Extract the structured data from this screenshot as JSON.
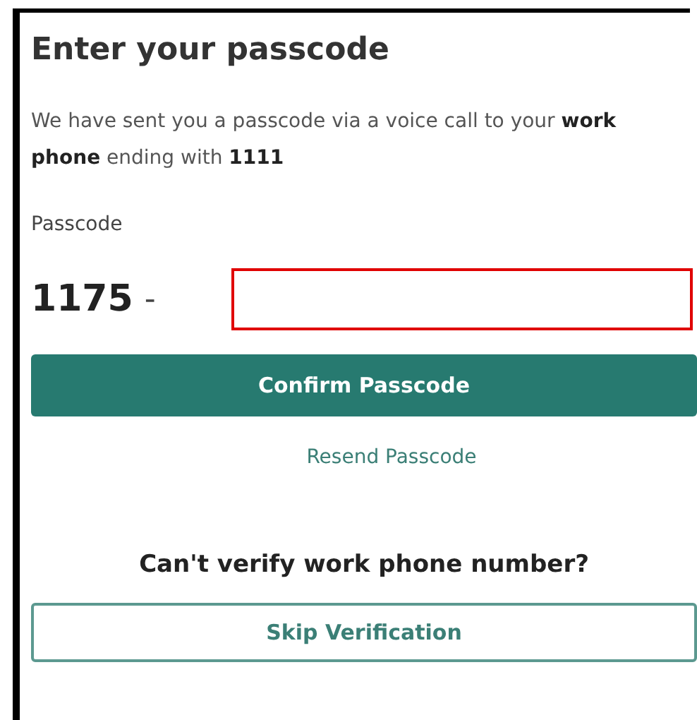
{
  "title": "Enter your passcode",
  "message": "We have sent you a passcode via a voice call to your **work phone** ending with **1111**",
  "passcode": {
    "label": "Passcode",
    "prefix": "1175",
    "separator": "-",
    "invalid": true
  },
  "confirm_button": "Confirm Passcode",
  "resend_link": "Resend Passcode",
  "alternative": {
    "heading": "Can't verify work phone number?",
    "button": "Skip Verification"
  }
}
